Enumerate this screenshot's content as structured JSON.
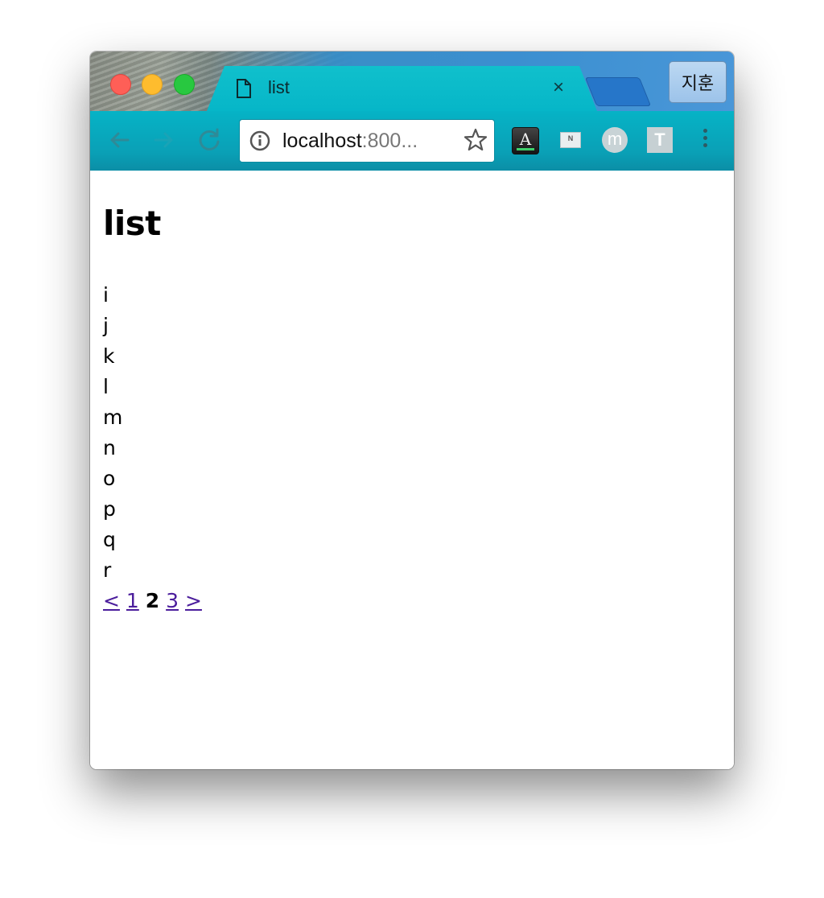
{
  "browser": {
    "tab": {
      "title": "list",
      "close_label": "×"
    },
    "profile_label": "지훈",
    "address": {
      "host": "localhost",
      "rest": ":800..."
    },
    "extensions": {
      "a_label": "A",
      "n_label": "N",
      "m_label": "m",
      "t_label": "T"
    }
  },
  "page": {
    "heading": "list",
    "items": [
      "i",
      "j",
      "k",
      "l",
      "m",
      "n",
      "o",
      "p",
      "q",
      "r"
    ],
    "pagination": {
      "prev": "<",
      "pages": [
        "1",
        "2",
        "3"
      ],
      "current": "2",
      "next": ">"
    }
  },
  "colors": {
    "link": "#4b1d9c",
    "toolbar": "#06b3c6",
    "tab": "#10c0cc"
  }
}
